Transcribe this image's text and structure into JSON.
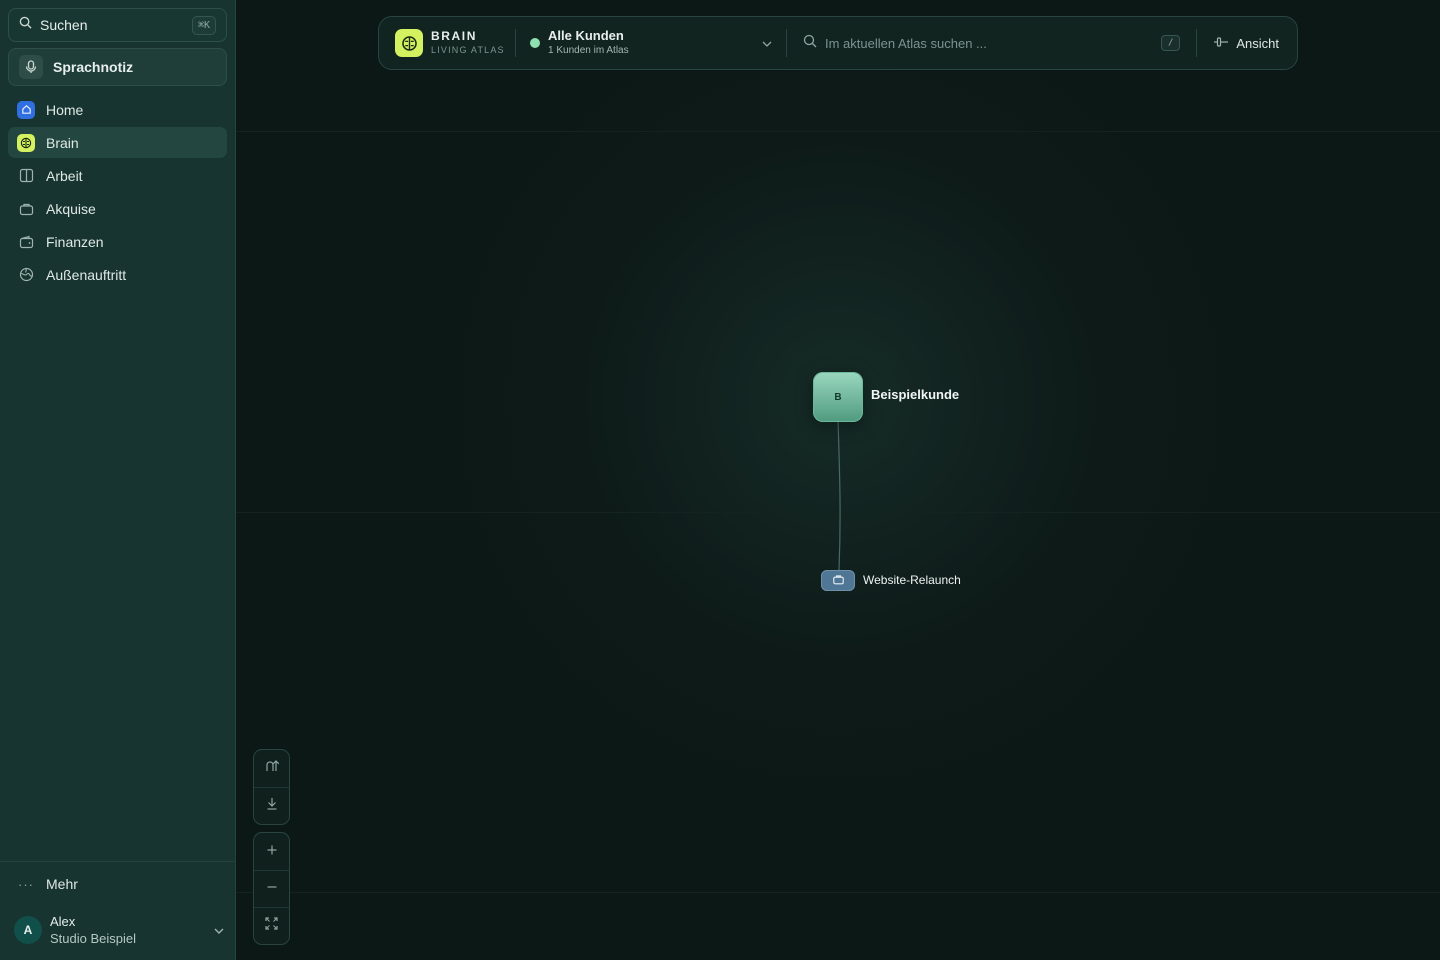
{
  "sidebar": {
    "search": {
      "label": "Suchen",
      "shortcut": "⌘K"
    },
    "voice_note": {
      "label": "Sprachnotiz"
    },
    "items": [
      {
        "label": "Home",
        "icon": "home-icon"
      },
      {
        "label": "Brain",
        "icon": "brain-icon",
        "active": true
      },
      {
        "label": "Arbeit",
        "icon": "columns-icon"
      },
      {
        "label": "Akquise",
        "icon": "briefcase-icon"
      },
      {
        "label": "Finanzen",
        "icon": "wallet-icon"
      },
      {
        "label": "Außenauftritt",
        "icon": "globe-icon"
      }
    ],
    "more": {
      "label": "Mehr"
    },
    "user": {
      "initial": "A",
      "name": "Alex",
      "org": "Studio Beispiel"
    }
  },
  "topbar": {
    "brand": {
      "title": "BRAIN",
      "subtitle": "LIVING ATLAS"
    },
    "client_selector": {
      "name": "Alle Kunden",
      "count": "1 Kunden im Atlas"
    },
    "atlas_search": {
      "placeholder": "Im aktuellen Atlas suchen ...",
      "shortcut": "/"
    },
    "view_button": {
      "label": "Ansicht"
    }
  },
  "graph": {
    "client_node": {
      "initial": "B",
      "label": "Beispielkunde"
    },
    "project_node": {
      "label": "Website-Relaunch",
      "icon": "briefcase-icon"
    }
  },
  "colors": {
    "accent_lime": "#d4f25f",
    "client_node": "#7cc3a6",
    "project_node": "#4f7694",
    "status_dot": "#8fe0b0",
    "home_icon_bg": "#2f6fe0"
  }
}
